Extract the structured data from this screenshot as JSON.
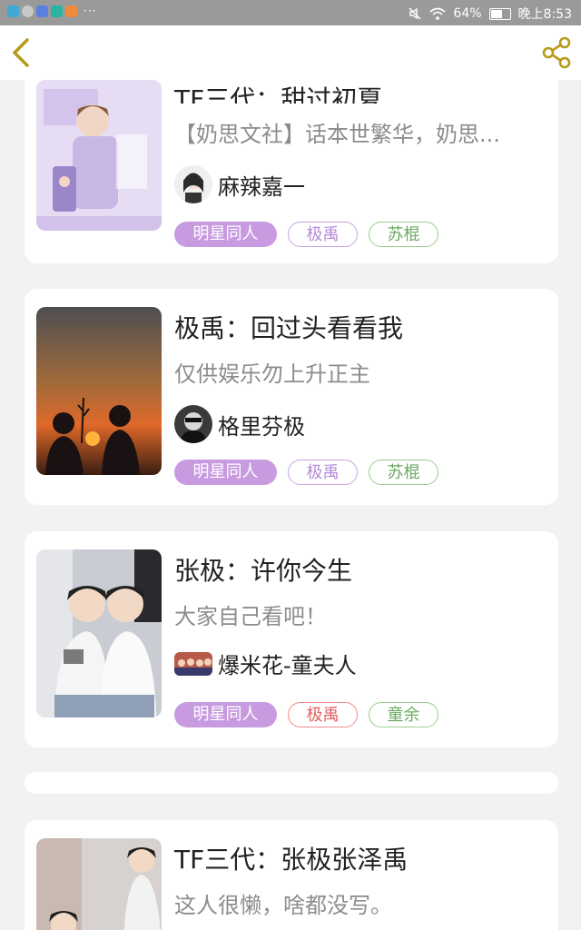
{
  "status_bar": {
    "battery": "64%",
    "time": "晚上8:53",
    "more": "···"
  },
  "colors": {
    "accent_purple": "#c89be0",
    "tag_purple": "#b58bd6",
    "tag_red": "#e26060",
    "tag_green": "#6aa860",
    "back_icon": "#b79a1a"
  },
  "icons": {
    "back": "chevron-left-icon",
    "share": "share-icon"
  },
  "works": [
    {
      "title": "TF三代：甜过初夏",
      "description": "【奶思文社】话本世繁华，奶思...",
      "author": "麻辣嘉一",
      "tags": [
        {
          "label": "明星同人",
          "style": "primary"
        },
        {
          "label": "极禹",
          "style": "purple"
        },
        {
          "label": "苏棍",
          "style": "green"
        }
      ]
    },
    {
      "title": "极禹：回过头看看我",
      "description": "仅供娱乐勿上升正主",
      "author": "格里芬极",
      "tags": [
        {
          "label": "明星同人",
          "style": "primary"
        },
        {
          "label": "极禹",
          "style": "purple"
        },
        {
          "label": "苏棍",
          "style": "green"
        }
      ]
    },
    {
      "title": "张极：许你今生",
      "description": "大家自己看吧！",
      "author": "爆米花-童夫人",
      "tags": [
        {
          "label": "明星同人",
          "style": "primary"
        },
        {
          "label": "极禹",
          "style": "red"
        },
        {
          "label": "童余",
          "style": "green"
        }
      ]
    },
    {
      "title": "TF三代：张极张泽禹",
      "description": "这人很懒，啥都没写。",
      "author": "",
      "tags": []
    }
  ]
}
